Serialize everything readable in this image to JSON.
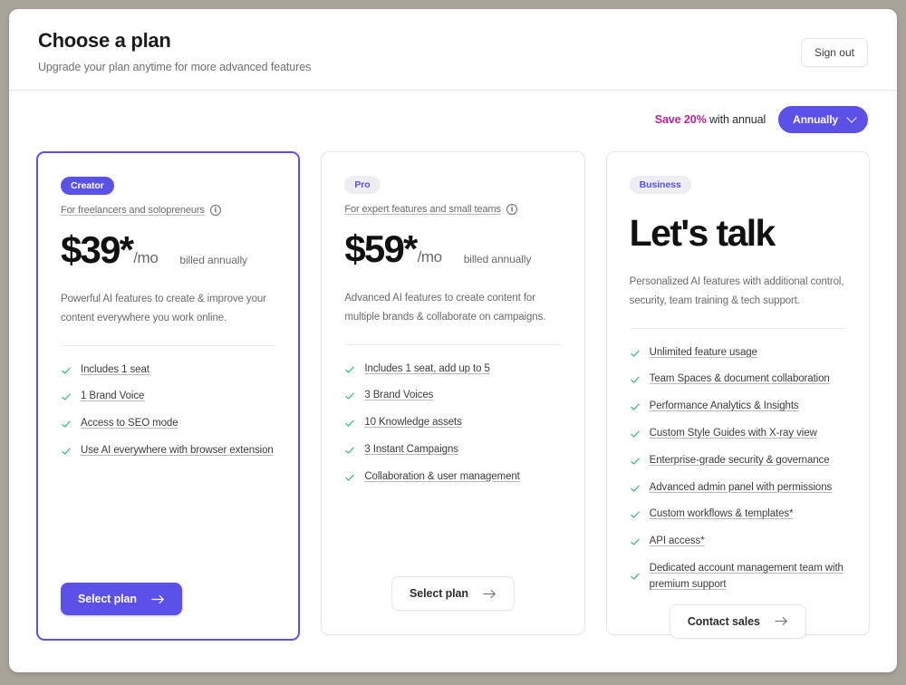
{
  "header": {
    "title": "Choose a plan",
    "subtitle": "Upgrade your plan anytime for more advanced features",
    "signout_label": "Sign out"
  },
  "billing": {
    "save_text": "Save 20%",
    "note_text": " with annual",
    "selected_period": "Annually"
  },
  "colors": {
    "brand_purple": "#5b50e8",
    "save_magenta": "#b5249b",
    "check_green": "#29b473",
    "page_background": "#a9a49a"
  },
  "plans": [
    {
      "badge": "Creator",
      "tagline": "For freelancers and solopreneurs",
      "price_amount": "$39*",
      "price_period": "/mo",
      "price_billed": "billed annually",
      "description": "Powerful AI features to create & improve your content everywhere you work online.",
      "features": [
        "Includes 1 seat",
        "1 Brand Voice",
        "Access to SEO mode",
        "Use AI everywhere with browser extension"
      ],
      "cta_label": "Select plan"
    },
    {
      "badge": "Pro",
      "tagline": "For expert features and small teams",
      "price_amount": "$59*",
      "price_period": "/mo",
      "price_billed": "billed annually",
      "description": "Advanced AI features to create content for multiple brands & collaborate on campaigns.",
      "features": [
        "Includes 1 seat, add up to 5",
        "3 Brand Voices",
        "10 Knowledge assets",
        "3 Instant Campaigns",
        "Collaboration & user management"
      ],
      "cta_label": "Select plan"
    },
    {
      "badge": "Business",
      "tagline": "",
      "price_amount": "Let's talk",
      "price_period": "",
      "price_billed": "",
      "description": "Personalized AI features with additional control, security, team training & tech support.",
      "features": [
        "Unlimited feature usage",
        "Team Spaces & document collaboration",
        "Performance Analytics & Insights",
        "Custom Style Guides with X-ray view",
        "Enterprise-grade security & governance",
        "Advanced admin panel with permissions",
        "Custom workflows & templates*",
        "API access*",
        "Dedicated account management team with premium support"
      ],
      "cta_label": "Contact sales"
    }
  ]
}
